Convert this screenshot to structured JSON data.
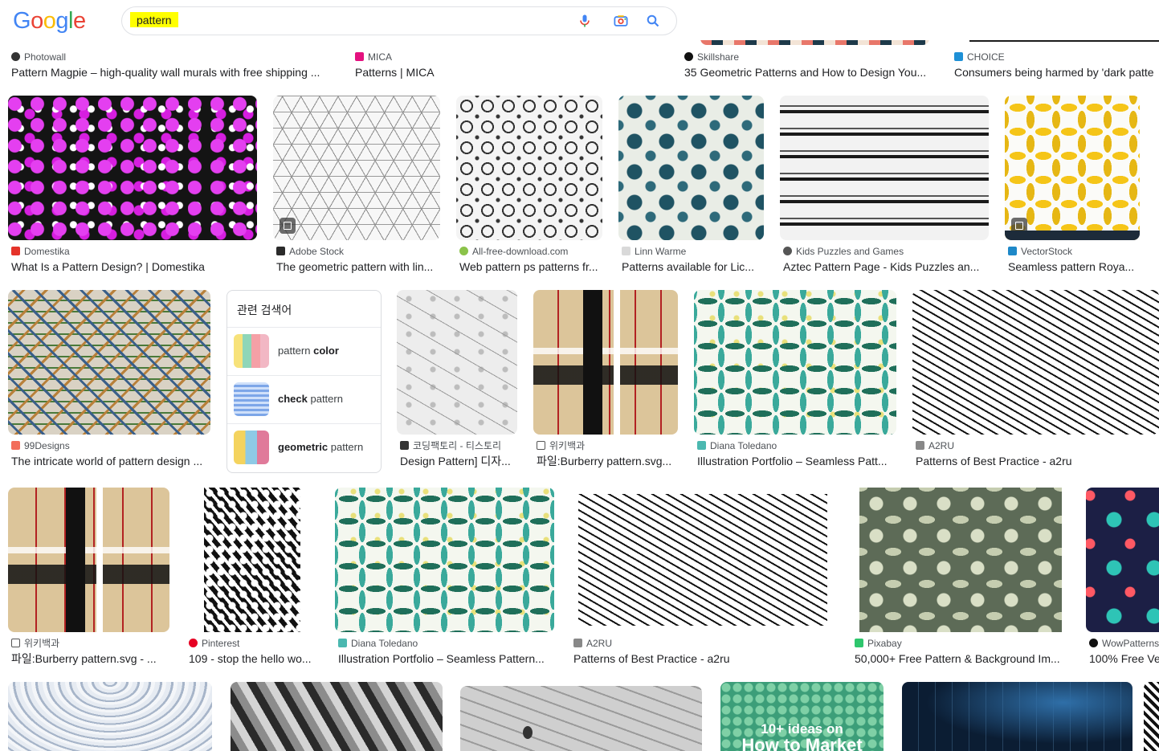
{
  "search": {
    "logo": [
      "G",
      "o",
      "o",
      "g",
      "l",
      "e"
    ],
    "logo_colors": [
      "#4285F4",
      "#EA4335",
      "#FBBC05",
      "#4285F4",
      "#34A853",
      "#EA4335"
    ],
    "query": "pattern"
  },
  "row0": [
    {
      "source": "Photowall",
      "title": "Pattern Magpie – high-quality wall murals with free shipping ..."
    },
    {
      "source": "MICA",
      "title": "Patterns | MICA"
    },
    {
      "source": "Skillshare",
      "title": "35 Geometric Patterns and How to Design You..."
    },
    {
      "source": "CHOICE",
      "title": "Consumers being harmed by 'dark patte"
    }
  ],
  "row1": [
    {
      "source": "Domestika",
      "title": "What Is a Pattern Design? | Domestika"
    },
    {
      "source": "Adobe Stock",
      "title": "The geometric pattern with lin..."
    },
    {
      "source": "All-free-download.com",
      "title": "Web pattern ps patterns fr..."
    },
    {
      "source": "Linn Warme",
      "title": "Patterns available for Lic..."
    },
    {
      "source": "Kids Puzzles and Games",
      "title": "Aztec Pattern Page - Kids Puzzles an..."
    },
    {
      "source": "VectorStock",
      "title": "Seamless pattern Roya..."
    }
  ],
  "related": {
    "title": "관련 검색어",
    "items": [
      {
        "pre": "pattern ",
        "bold": "color",
        "post": ""
      },
      {
        "pre": "",
        "bold": "check",
        "post": " pattern"
      },
      {
        "pre": "",
        "bold": "geometric",
        "post": " pattern"
      }
    ]
  },
  "row2": [
    {
      "source": "99Designs",
      "title": "The intricate world of pattern design ..."
    },
    {
      "source": "코딩팩토리 - 티스토리",
      "title": "Design Pattern] 디자..."
    },
    {
      "source": "위키백과",
      "title": "파일:Burberry pattern.svg..."
    },
    {
      "source": "Diana Toledano",
      "title": "Illustration Portfolio – Seamless Patt..."
    },
    {
      "source": "A2RU",
      "title": "Patterns of Best Practice - a2ru"
    }
  ],
  "row3": [
    {
      "source": "위키백과",
      "title": "파일:Burberry pattern.svg - ..."
    },
    {
      "source": "Pinterest",
      "title": "109 - stop the hello wo..."
    },
    {
      "source": "Diana Toledano",
      "title": "Illustration Portfolio – Seamless Pattern..."
    },
    {
      "source": "A2RU",
      "title": "Patterns of Best Practice - a2ru"
    },
    {
      "source": "Pixabay",
      "title": "50,000+ Free Pattern & Background Im..."
    },
    {
      "source": "WowPatterns",
      "title": "100% Free Ve"
    }
  ],
  "row4_overlay_text": [
    "10+ ideas on",
    "How to Market"
  ],
  "colors": {
    "link": "#202124",
    "source": "#4d5156",
    "highlight": "#ffff00"
  }
}
